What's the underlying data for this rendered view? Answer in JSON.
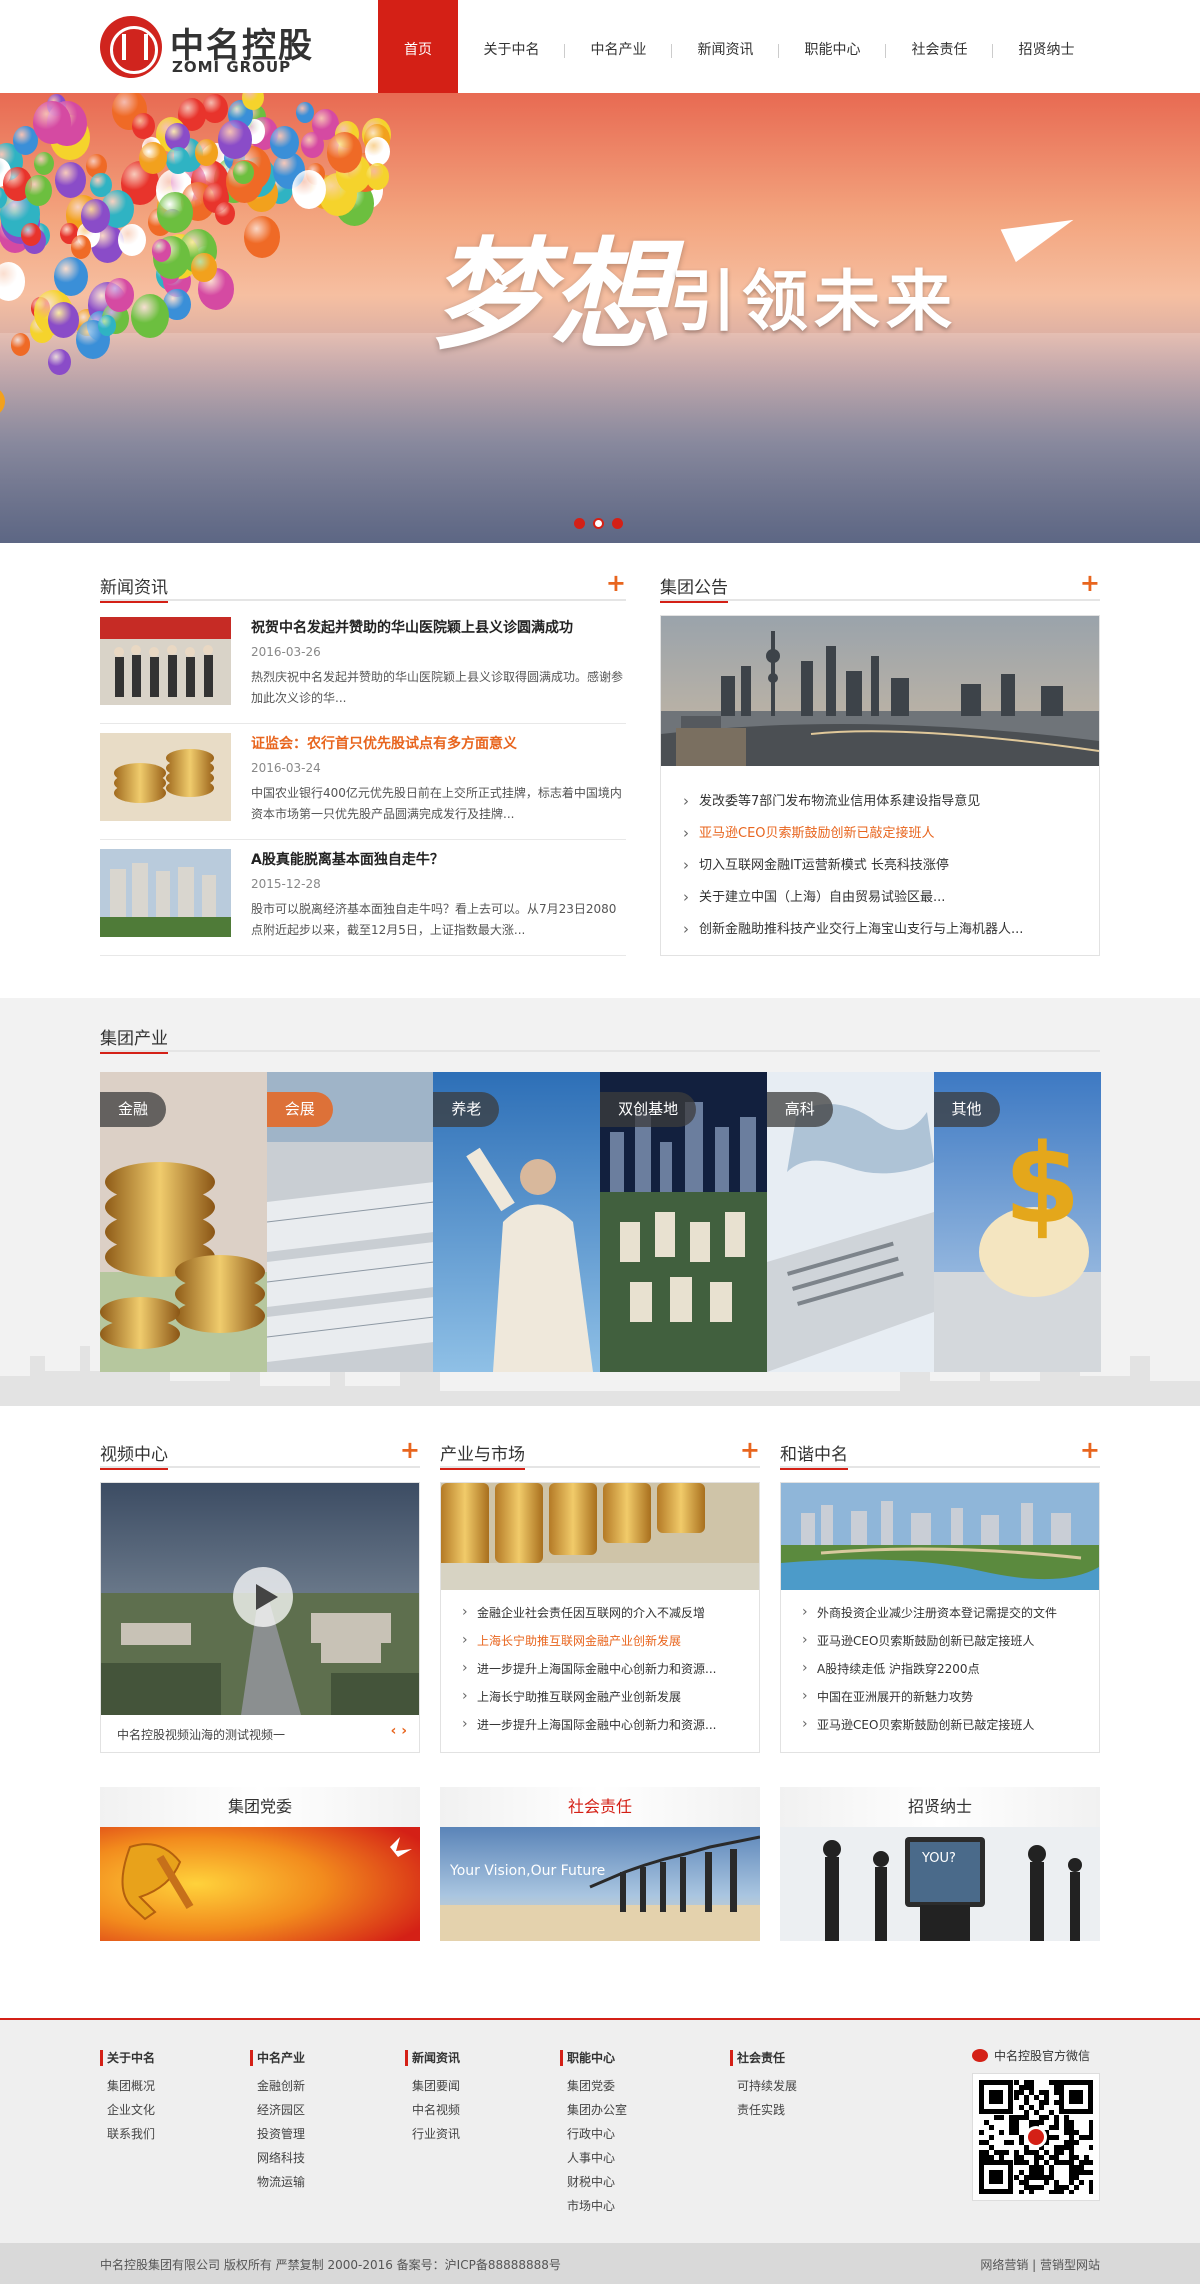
{
  "header": {
    "logo_cn": "中名控股",
    "logo_en": "ZOMI GROUP",
    "nav": [
      "首页",
      "关于中名",
      "中名产业",
      "新闻资讯",
      "职能中心",
      "社会责任",
      "招贤纳士"
    ],
    "active_index": 0
  },
  "banner": {
    "script_text": "梦想",
    "main_text": "引领未来",
    "slides": 3,
    "active_slide": 1
  },
  "news": {
    "title": "新闻资讯",
    "more": "+",
    "items": [
      {
        "title": "祝贺中名发起并赞助的华山医院颖上县义诊圆满成功",
        "date": "2016-03-26",
        "desc": "热烈庆祝中名发起并赞助的华山医院颖上县义诊取得圆满成功。感谢参加此次义诊的华...",
        "highlight": false
      },
      {
        "title": "证监会：农行首只优先股试点有多方面意义",
        "date": "2016-03-24",
        "desc": "中国农业银行400亿元优先股日前在上交所正式挂牌，标志着中国境内资本市场第一只优先股产品圆满完成发行及挂牌...",
        "highlight": true
      },
      {
        "title": "A股真能脱离基本面独自走牛？",
        "date": "2015-12-28",
        "desc": "股市可以脱离经济基本面独自走牛吗？看上去可以。从7月23日2080点附近起步以来，截至12月5日，上证指数最大涨...",
        "highlight": false
      }
    ]
  },
  "notice": {
    "title": "集团公告",
    "more": "+",
    "items": [
      {
        "text": "发改委等7部门发布物流业信用体系建设指导意见",
        "highlight": false
      },
      {
        "text": "亚马逊CEO贝索斯鼓励创新已敲定接班人",
        "highlight": true
      },
      {
        "text": "切入互联网金融IT运营新模式 长亮科技涨停",
        "highlight": false
      },
      {
        "text": "关于建立中国（上海）自由贸易试验区最...",
        "highlight": false
      },
      {
        "text": "创新金融助推科技产业交行上海宝山支行与上海机器人...",
        "highlight": false
      }
    ]
  },
  "industry": {
    "title": "集团产业",
    "panels": [
      {
        "label": "金融",
        "accent": false
      },
      {
        "label": "会展",
        "accent": true
      },
      {
        "label": "养老",
        "accent": false
      },
      {
        "label": "双创基地",
        "accent": false
      },
      {
        "label": "高科",
        "accent": false
      },
      {
        "label": "其他",
        "accent": false
      }
    ]
  },
  "video": {
    "title": "视频中心",
    "more": "+",
    "caption": "中名控股视频汕海的测试视频一",
    "arrows": "‹ ›"
  },
  "market": {
    "title": "产业与市场",
    "more": "+",
    "items": [
      {
        "text": "金融企业社会责任因互联网的介入不减反增",
        "highlight": false
      },
      {
        "text": "上海长宁助推互联网金融产业创新发展",
        "highlight": true
      },
      {
        "text": "进一步提升上海国际金融中心创新力和资源...",
        "highlight": false
      },
      {
        "text": "上海长宁助推互联网金融产业创新发展",
        "highlight": false
      },
      {
        "text": "进一步提升上海国际金融中心创新力和资源...",
        "highlight": false
      }
    ]
  },
  "harmony": {
    "title": "和谐中名",
    "more": "+",
    "items": [
      {
        "text": "外商投资企业减少注册资本登记需提交的文件",
        "highlight": false
      },
      {
        "text": "亚马逊CEO贝索斯鼓励创新已敲定接班人",
        "highlight": false
      },
      {
        "text": "A股持续走低 沪指跌穿2200点",
        "highlight": false
      },
      {
        "text": "中国在亚洲展开的新魅力攻势",
        "highlight": false
      },
      {
        "text": "亚马逊CEO贝索斯鼓励创新已敲定接班人",
        "highlight": false
      }
    ]
  },
  "bottom_banners": [
    {
      "title": "集团党委",
      "red": false
    },
    {
      "title": "社会责任",
      "red": true,
      "overlay": "Your Vision,Our Future"
    },
    {
      "title": "招贤纳士",
      "red": false,
      "overlay": "YOU?"
    }
  ],
  "footer": {
    "columns": [
      {
        "head": "关于中名",
        "links": [
          "集团概况",
          "企业文化",
          "联系我们"
        ]
      },
      {
        "head": "中名产业",
        "links": [
          "金融创新",
          "经济园区",
          "投资管理",
          "网络科技",
          "物流运输"
        ]
      },
      {
        "head": "新闻资讯",
        "links": [
          "集团要闻",
          "中名视频",
          "行业资讯"
        ]
      },
      {
        "head": "职能中心",
        "links": [
          "集团党委",
          "集团办公室",
          "行政中心",
          "人事中心",
          "财税中心",
          "市场中心"
        ]
      },
      {
        "head": "社会责任",
        "links": [
          "可持续发展",
          "责任实践"
        ]
      }
    ],
    "wechat": "中名控股官方微信",
    "copyright": "中名控股集团有限公司  版权所有  严禁复制  2000-2016    备案号：沪ICP备88888888号",
    "right_links": "网络营销 | 营销型网站"
  },
  "colors": {
    "brand_red": "#d42016",
    "accent_orange": "#e8651e"
  }
}
